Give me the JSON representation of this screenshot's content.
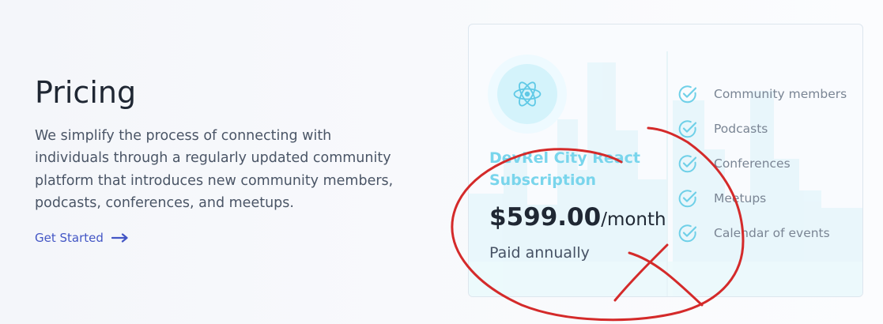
{
  "intro": {
    "title": "Pricing",
    "description": "We simplify the process of connecting with individuals through a regularly updated community platform that introduces new community members, podcasts, conferences, and meetups.",
    "cta_label": "Get Started",
    "cta_icon": "arrow-right-icon"
  },
  "plan": {
    "logo_icon": "react-atom-icon",
    "name": "DevRel City React Subscription",
    "price": "$599.00",
    "period": "/month",
    "billing": "Paid annually",
    "features": [
      "Community members",
      "Podcasts",
      "Conferences",
      "Meetups",
      "Calendar of events"
    ],
    "feature_icon": "check-circle-icon"
  },
  "colors": {
    "accent": "#79d5ec",
    "link": "#4356c5",
    "annotation": "#d42a2a"
  }
}
